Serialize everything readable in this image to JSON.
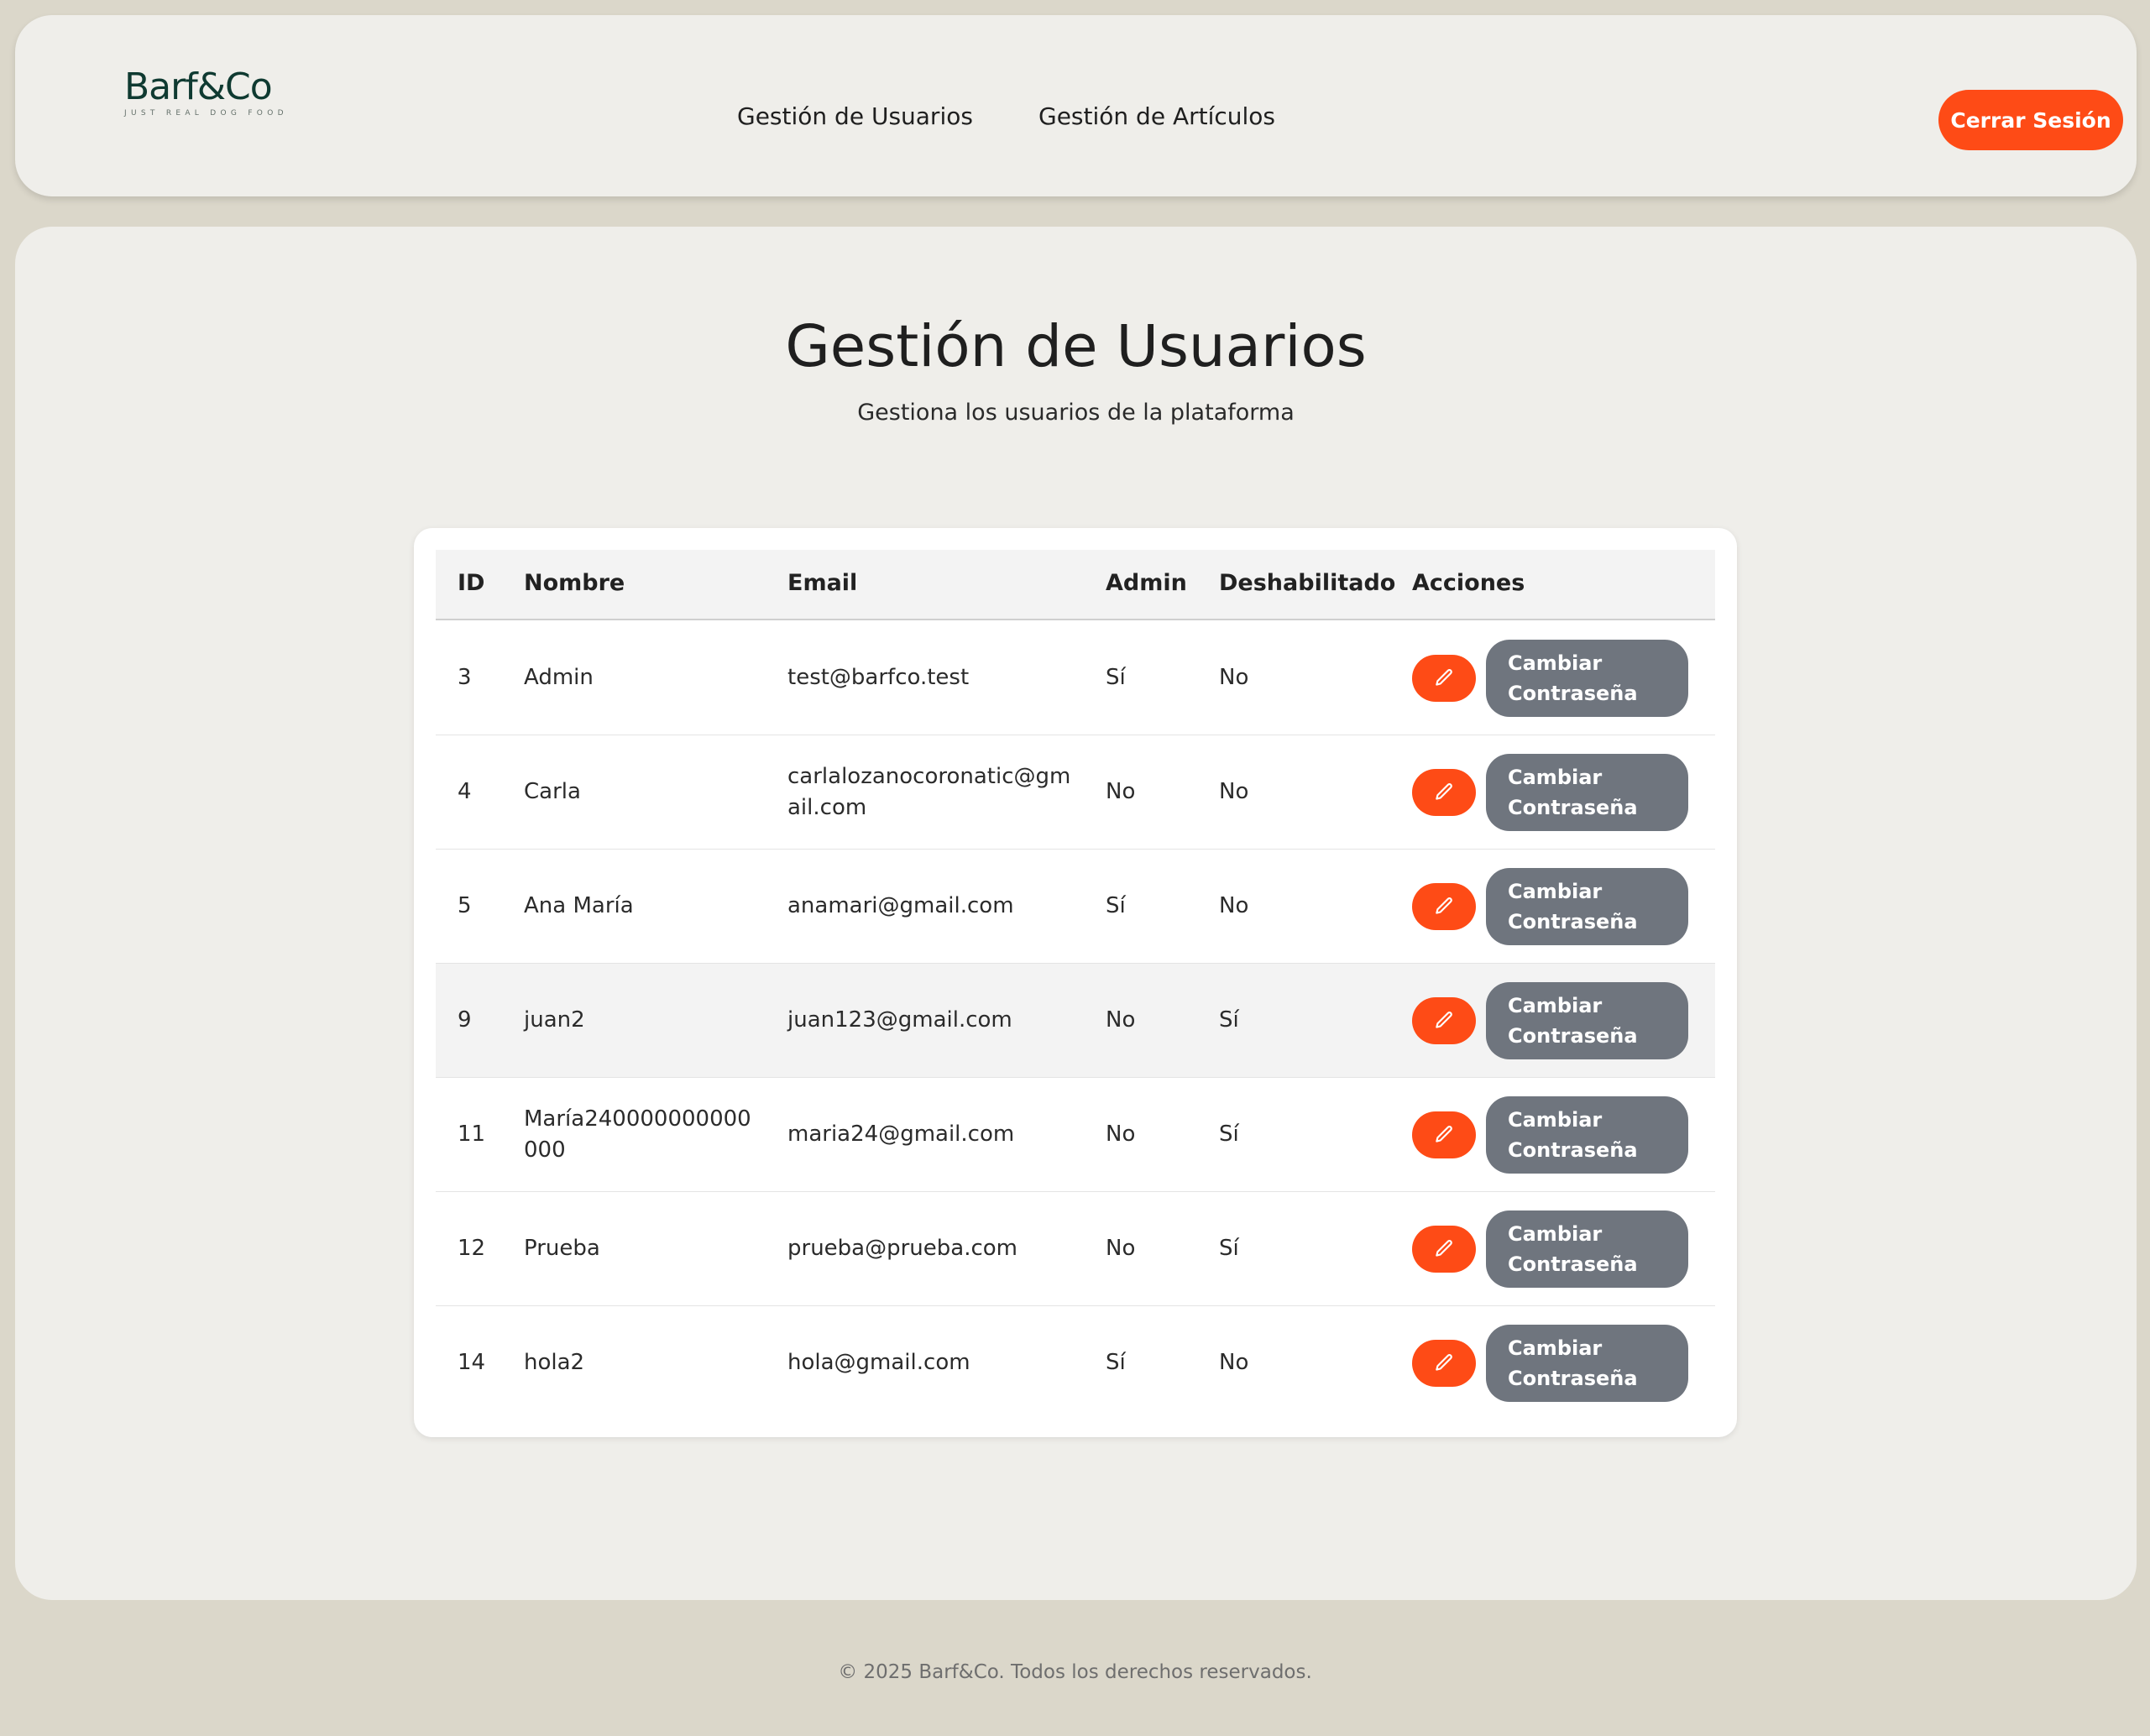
{
  "header": {
    "logo_name": "Barf&Co",
    "logo_tagline": "JUST REAL DOG FOOD",
    "nav": [
      "Gestión de Usuarios",
      "Gestión de Artículos"
    ],
    "logout_label": "Cerrar Sesión"
  },
  "main": {
    "title": "Gestión de Usuarios",
    "subtitle": "Gestiona los usuarios de la plataforma"
  },
  "table": {
    "headers": [
      "ID",
      "Nombre",
      "Email",
      "Admin",
      "Deshabilitado",
      "Acciones"
    ],
    "rows": [
      {
        "id": "3",
        "nombre": "Admin",
        "email": "test@barfco.test",
        "admin": "Sí",
        "deshabilitado": "No",
        "action_label": "Cambiar Contraseña"
      },
      {
        "id": "4",
        "nombre": "Carla",
        "email": "carlalozanocoronatic@gmail.com",
        "admin": "No",
        "deshabilitado": "No",
        "action_label": "Cambiar Contraseña"
      },
      {
        "id": "5",
        "nombre": "Ana María",
        "email": "anamari@gmail.com",
        "admin": "Sí",
        "deshabilitado": "No",
        "action_label": "Cambiar Contraseña"
      },
      {
        "id": "9",
        "nombre": "juan2",
        "email": "juan123@gmail.com",
        "admin": "No",
        "deshabilitado": "Sí",
        "action_label": "Cambiar Contraseña"
      },
      {
        "id": "11",
        "nombre": "María240000000000000",
        "email": "maria24@gmail.com",
        "admin": "No",
        "deshabilitado": "Sí",
        "action_label": "Cambiar Contraseña"
      },
      {
        "id": "12",
        "nombre": "Prueba",
        "email": "prueba@prueba.com",
        "admin": "No",
        "deshabilitado": "Sí",
        "action_label": "Cambiar Contraseña"
      },
      {
        "id": "14",
        "nombre": "hola2",
        "email": "hola@gmail.com",
        "admin": "Sí",
        "deshabilitado": "No",
        "action_label": "Cambiar Contraseña"
      }
    ],
    "edit_icon": "pencil-icon"
  },
  "footer": {
    "text": "© 2025 Barf&Co. Todos los derechos reservados."
  },
  "colors": {
    "accent": "#fe4b16",
    "secondary_button": "#6f757e",
    "background": "#dbd7ca",
    "panel": "#efeeea",
    "brand": "#0f3a31"
  }
}
